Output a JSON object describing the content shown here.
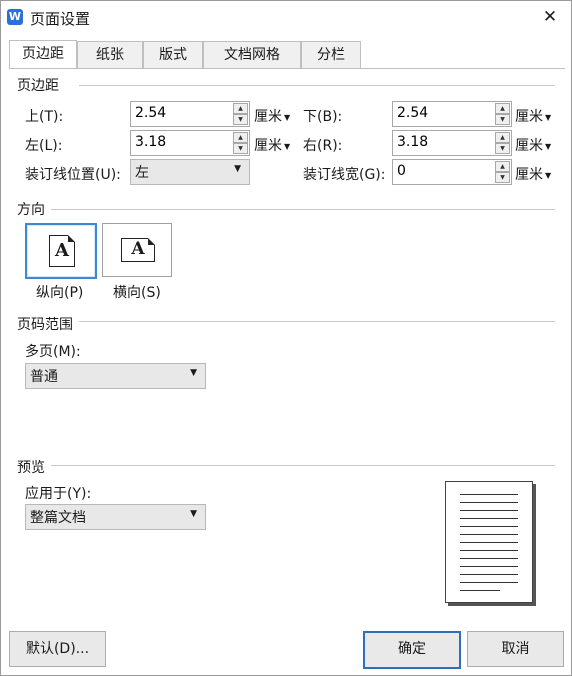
{
  "window": {
    "title": "页面设置",
    "app_icon": "W"
  },
  "tabs": [
    "页边距",
    "纸张",
    "版式",
    "文档网格",
    "分栏"
  ],
  "margins": {
    "title": "页边距",
    "top_label": "上(T):",
    "top_value": "2.54",
    "bottom_label": "下(B):",
    "bottom_value": "2.54",
    "left_label": "左(L):",
    "left_value": "3.18",
    "right_label": "右(R):",
    "right_value": "3.18",
    "gutter_pos_label": "装订线位置(U):",
    "gutter_pos_value": "左",
    "gutter_width_label": "装订线宽(G):",
    "gutter_width_value": "0",
    "unit": "厘米"
  },
  "orientation": {
    "title": "方向",
    "glyph_letter": "A",
    "portrait_label": "纵向(P)",
    "landscape_label": "横向(S)",
    "selected": "portrait"
  },
  "page_range": {
    "title": "页码范围",
    "multiple_label": "多页(M):",
    "multiple_value": "普通"
  },
  "preview": {
    "title": "预览",
    "apply_label": "应用于(Y):",
    "apply_value": "整篇文档"
  },
  "buttons": {
    "default": "默认(D)...",
    "ok": "确定",
    "cancel": "取消"
  },
  "icons": {
    "close": "close-icon",
    "spin_up": "spin-up-icon",
    "spin_down": "spin-down-icon",
    "dropdown": "chevron-down-icon"
  },
  "colors": {
    "accent": "#2b6fd8",
    "selected_border": "#3c8ad6"
  }
}
